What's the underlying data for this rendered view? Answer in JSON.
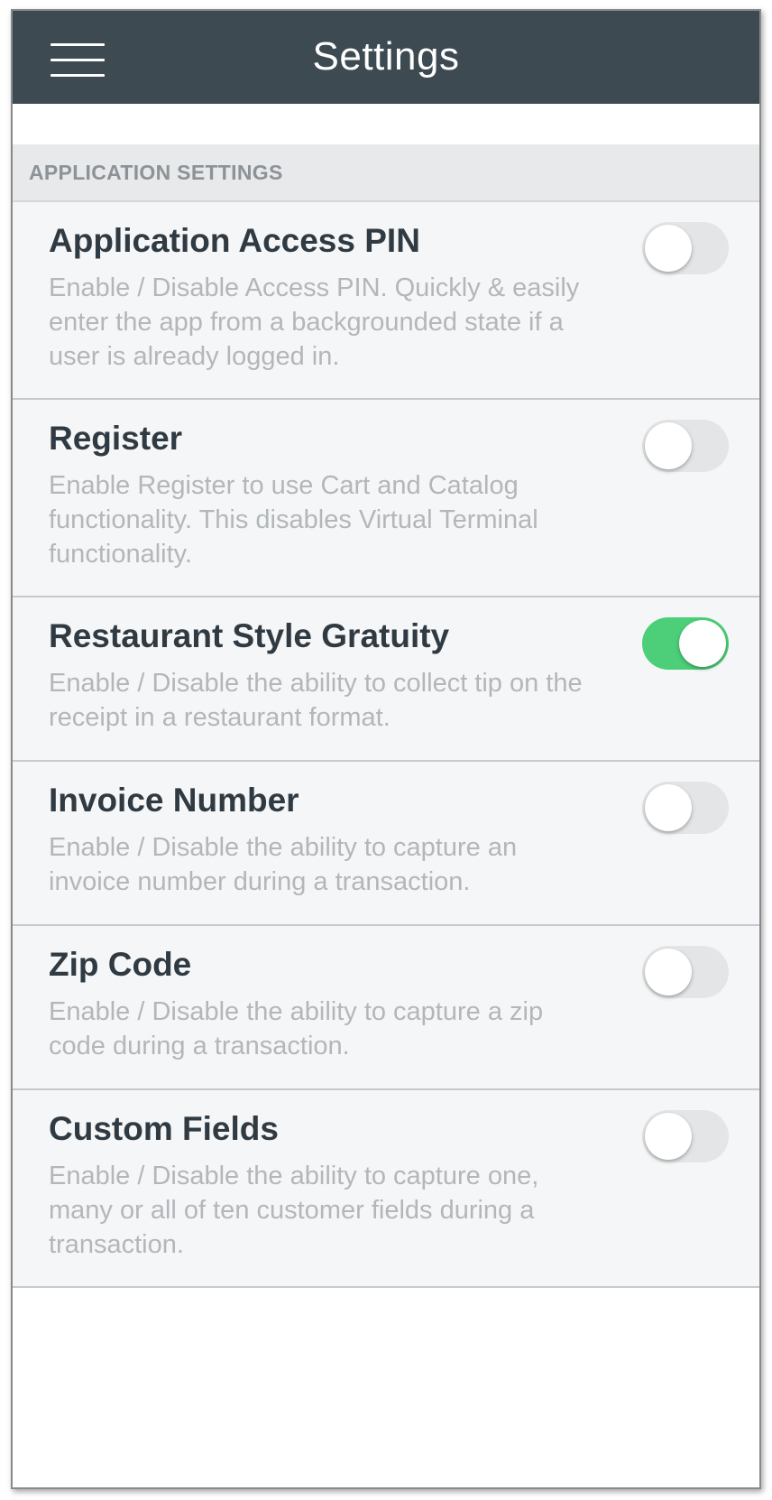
{
  "header": {
    "title": "Settings",
    "menu_icon": "hamburger-menu-icon",
    "background_color": "#3d4a52"
  },
  "section": {
    "label": "APPLICATION SETTINGS"
  },
  "settings": [
    {
      "title": "Application Access PIN",
      "description": "Enable / Disable Access PIN. Quickly & easily enter the app from a backgrounded state if a user is already logged in.",
      "enabled": false
    },
    {
      "title": "Register",
      "description": "Enable Register to use Cart and Catalog functionality. This disables Virtual Terminal functionality.",
      "enabled": false
    },
    {
      "title": "Restaurant Style Gratuity",
      "description": "Enable / Disable the ability to collect tip on the receipt in a restaurant format.",
      "enabled": true
    },
    {
      "title": "Invoice Number",
      "description": "Enable / Disable the ability to capture an invoice number during a transaction.",
      "enabled": false
    },
    {
      "title": "Zip Code",
      "description": "Enable / Disable the ability to capture a zip code during a transaction.",
      "enabled": false
    },
    {
      "title": "Custom Fields",
      "description": "Enable / Disable the ability to capture one, many or all of ten customer fields during a transaction.",
      "enabled": false
    }
  ],
  "colors": {
    "toggle_on": "#4ccf78",
    "toggle_off": "#e3e5e6"
  }
}
